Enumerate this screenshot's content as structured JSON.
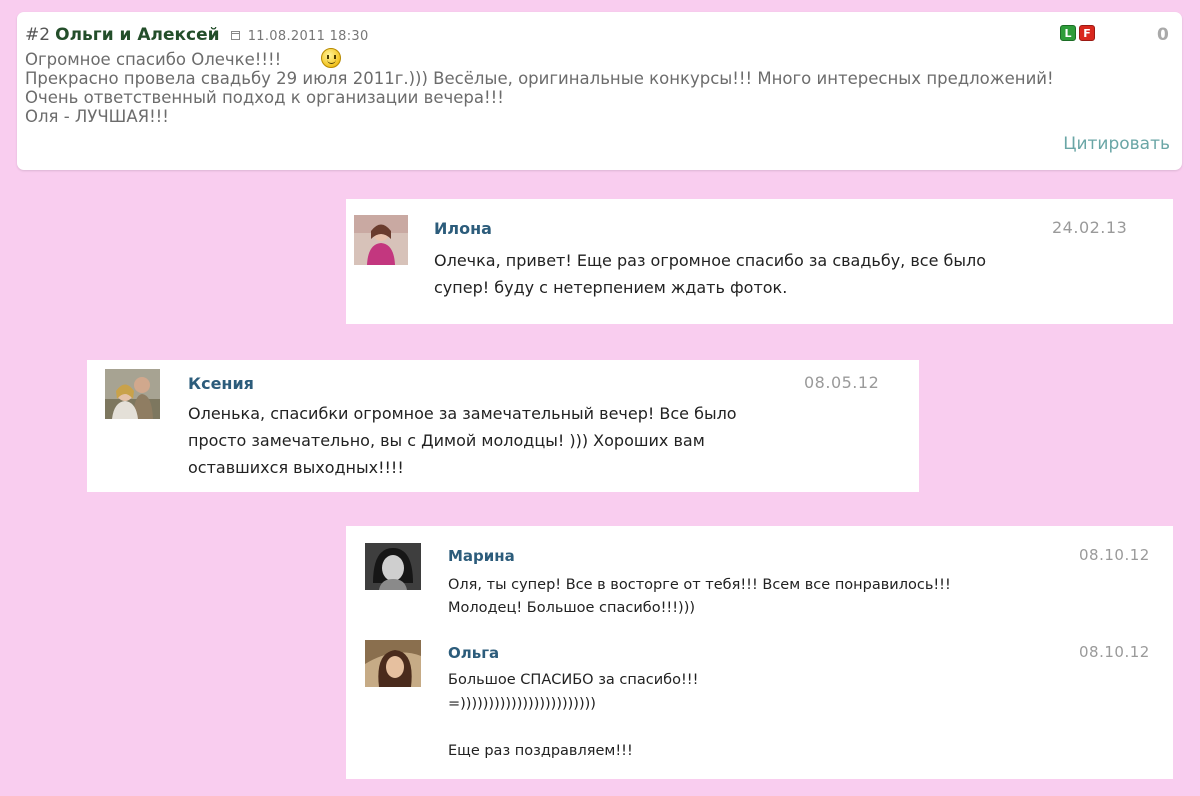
{
  "post": {
    "number": "#2",
    "author": "Ольги и Алексей",
    "date": "11.08.2011 18:30",
    "rating": "0",
    "quote_label": "Цитировать",
    "lines": [
      "Огромное спасибо Олечке!!!!",
      "Прекрасно провела свадьбу 29 июля 2011г.))) Весёлые, оригинальные конкурсы!!! Много интересных предложений!",
      "Очень ответственный подход к организации вечера!!!",
      "Оля - ЛУЧШАЯ!!!"
    ],
    "icons": [
      "smiley-icon",
      "calendar-icon",
      "like-icon",
      "report-icon"
    ]
  },
  "comments": [
    {
      "name": "Илона",
      "date": "24.02.13",
      "lines": [
        "Олечка, привет! Еще раз огромное спасибо за свадьбу, все было",
        "супер! буду с нетерпением ждать фоток."
      ]
    },
    {
      "name": "Ксения",
      "date": "08.05.12",
      "lines": [
        "Оленька, спасибки огромное за замечательный вечер! Все было",
        "просто замечательно, вы с Димой молодцы! ))) Хороших вам",
        "оставшихся выходных!!!!"
      ]
    },
    {
      "name": "Марина",
      "date": "08.10.12",
      "lines": [
        "Оля, ты супер! Все в восторге от тебя!!! Всем все понравилось!!!",
        "Молодец! Большое спасибо!!!)))"
      ]
    },
    {
      "name": "Ольга",
      "date": "08.10.12",
      "lines": [
        "Большое СПАСИБО за спасибо!!!",
        "=))))))))))))))))))))))))",
        "",
        "Еще раз поздравляем!!!"
      ]
    }
  ],
  "colors": {
    "background": "#f9cdef",
    "author": "#234e2a",
    "comment_name": "#2c5c7b",
    "quote_link": "#6aa6a6"
  }
}
